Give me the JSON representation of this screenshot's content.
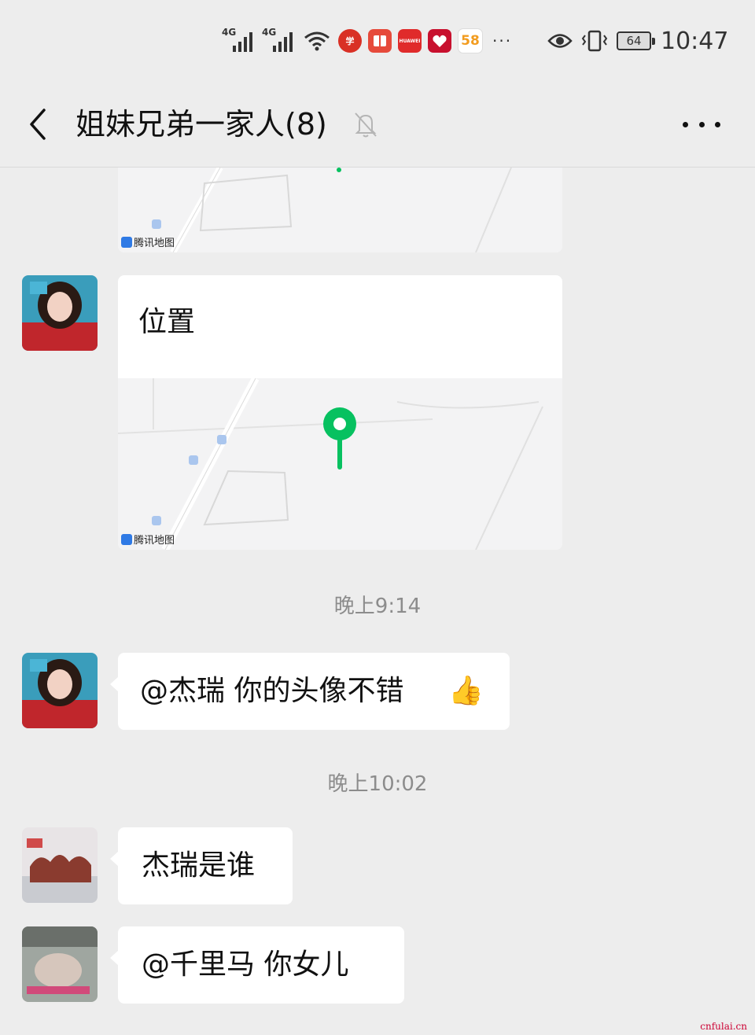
{
  "status_bar": {
    "network_1": "4G",
    "network_2": "4G",
    "app_58": "58",
    "app_huawei": "HUAWEI",
    "more": "···",
    "battery": "64",
    "time": "10:47"
  },
  "header": {
    "title": "姐妹兄弟一家人(8)"
  },
  "map_partial": {
    "provider": "腾讯地图",
    "pin_color": "#07c160"
  },
  "messages": [
    {
      "type": "location",
      "title": "位置",
      "provider": "腾讯地图",
      "pin_color": "#07c160"
    },
    {
      "type": "time",
      "text": "晚上9:14"
    },
    {
      "type": "text",
      "text": "@杰瑞  你的头像不错",
      "emoji": "👍"
    },
    {
      "type": "time",
      "text": "晚上10:02"
    },
    {
      "type": "text",
      "text": "杰瑞是谁"
    },
    {
      "type": "text",
      "text": "@千里马  你女儿"
    }
  ],
  "watermark": "cnfulai.cn",
  "colors": {
    "background": "#ededed",
    "bubble": "#ffffff",
    "accent_green": "#07c160"
  }
}
